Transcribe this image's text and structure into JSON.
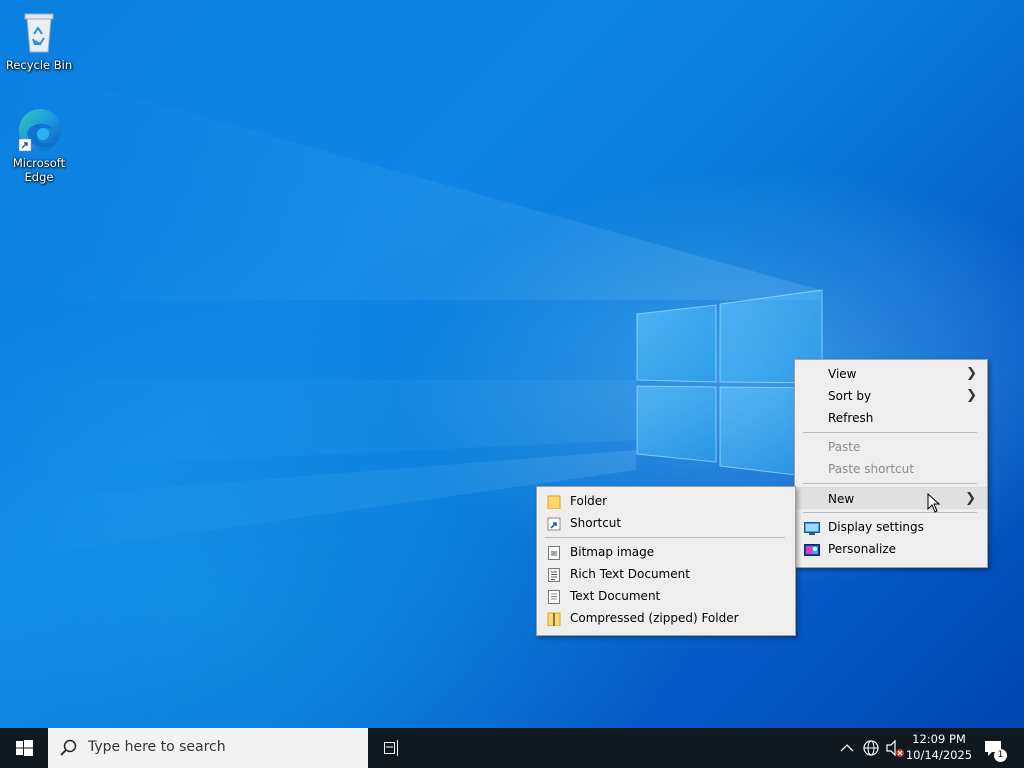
{
  "desktop": {
    "icons": [
      {
        "label": "Recycle Bin",
        "icon": "recycle-bin-icon"
      },
      {
        "label": "Microsoft\nEdge",
        "icon": "edge-icon"
      }
    ]
  },
  "context_menu": {
    "view": "View",
    "sort_by": "Sort by",
    "refresh": "Refresh",
    "paste": "Paste",
    "paste_shortcut": "Paste shortcut",
    "new": "New",
    "display_settings": "Display settings",
    "personalize": "Personalize"
  },
  "new_submenu": {
    "folder": "Folder",
    "shortcut": "Shortcut",
    "bitmap": "Bitmap image",
    "rtf": "Rich Text Document",
    "text": "Text Document",
    "zip": "Compressed (zipped) Folder"
  },
  "taskbar": {
    "search_placeholder": "Type here to search",
    "time": "12:09 PM",
    "date": "10/14/2025",
    "notification_count": "1"
  },
  "colors": {
    "taskbar": "#101820",
    "menu_bg": "#eeeeee",
    "desktop_blue": "#0a7fe0"
  }
}
